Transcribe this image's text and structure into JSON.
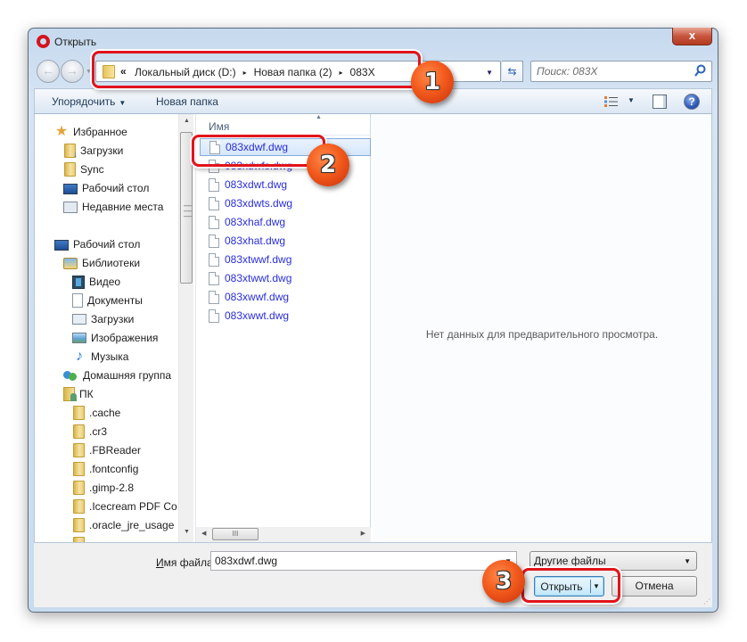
{
  "window": {
    "title": "Открыть",
    "close_label": "x"
  },
  "navigation": {
    "back_label": "←",
    "forward_label": "→",
    "address": {
      "chevron": "«",
      "crumbs": [
        "Локальный диск (D:)",
        "Новая папка (2)",
        "083X"
      ],
      "separator": "▸"
    },
    "refresh_label": "⇆",
    "search": {
      "placeholder": "Поиск: 083X",
      "value": ""
    }
  },
  "toolbar": {
    "organize_label": "Упорядочить",
    "new_folder_label": "Новая папка",
    "caret": "▼"
  },
  "sidebar": {
    "items": [
      {
        "label": "Избранное",
        "icon": "star-icon"
      },
      {
        "label": "Загрузки",
        "icon": "downloads-folder-icon"
      },
      {
        "label": "Sync",
        "icon": "folder-icon"
      },
      {
        "label": "Рабочий стол",
        "icon": "desktop-icon"
      },
      {
        "label": "Недавние места",
        "icon": "recent-places-icon"
      },
      {
        "label": "Рабочий стол",
        "icon": "desktop-icon"
      },
      {
        "label": "Библиотеки",
        "icon": "libraries-icon"
      },
      {
        "label": "Видео",
        "icon": "video-library-icon"
      },
      {
        "label": "Документы",
        "icon": "documents-library-icon"
      },
      {
        "label": "Загрузки",
        "icon": "downloads-library-icon"
      },
      {
        "label": "Изображения",
        "icon": "pictures-library-icon"
      },
      {
        "label": "Музыка",
        "icon": "music-library-icon"
      },
      {
        "label": "Домашняя группа",
        "icon": "homegroup-icon"
      },
      {
        "label": "ПК",
        "icon": "user-folder-icon"
      },
      {
        "label": ".cache",
        "icon": "folder-icon"
      },
      {
        "label": ".cr3",
        "icon": "folder-icon"
      },
      {
        "label": ".FBReader",
        "icon": "folder-icon"
      },
      {
        "label": ".fontconfig",
        "icon": "folder-icon"
      },
      {
        "label": ".gimp-2.8",
        "icon": "folder-icon"
      },
      {
        "label": ".Icecream PDF Co",
        "icon": "folder-icon"
      },
      {
        "label": ".oracle_jre_usage",
        "icon": "folder-icon"
      }
    ]
  },
  "file_list": {
    "column_name": "Имя",
    "files": [
      {
        "name": "083xdwf.dwg",
        "selected": true
      },
      {
        "name": "083xdwfs.dwg",
        "selected": false
      },
      {
        "name": "083xdwt.dwg",
        "selected": false
      },
      {
        "name": "083xdwts.dwg",
        "selected": false
      },
      {
        "name": "083xhaf.dwg",
        "selected": false
      },
      {
        "name": "083xhat.dwg",
        "selected": false
      },
      {
        "name": "083xtwwf.dwg",
        "selected": false
      },
      {
        "name": "083xtwwt.dwg",
        "selected": false
      },
      {
        "name": "083xwwf.dwg",
        "selected": false
      },
      {
        "name": "083xwwt.dwg",
        "selected": false
      }
    ],
    "hscroll_grip": "III"
  },
  "preview": {
    "message": "Нет данных для предварительного просмотра."
  },
  "bottom": {
    "filename_label_underlined": "И",
    "filename_label_rest": "мя файла:",
    "filename_value": "083xdwf.dwg",
    "filetype_value": "Другие файлы",
    "open_label": "Открыть",
    "cancel_label": "Отмена"
  },
  "annotations": {
    "step1": "1",
    "step2": "2",
    "step3": "3",
    "color": "#e2131b"
  }
}
